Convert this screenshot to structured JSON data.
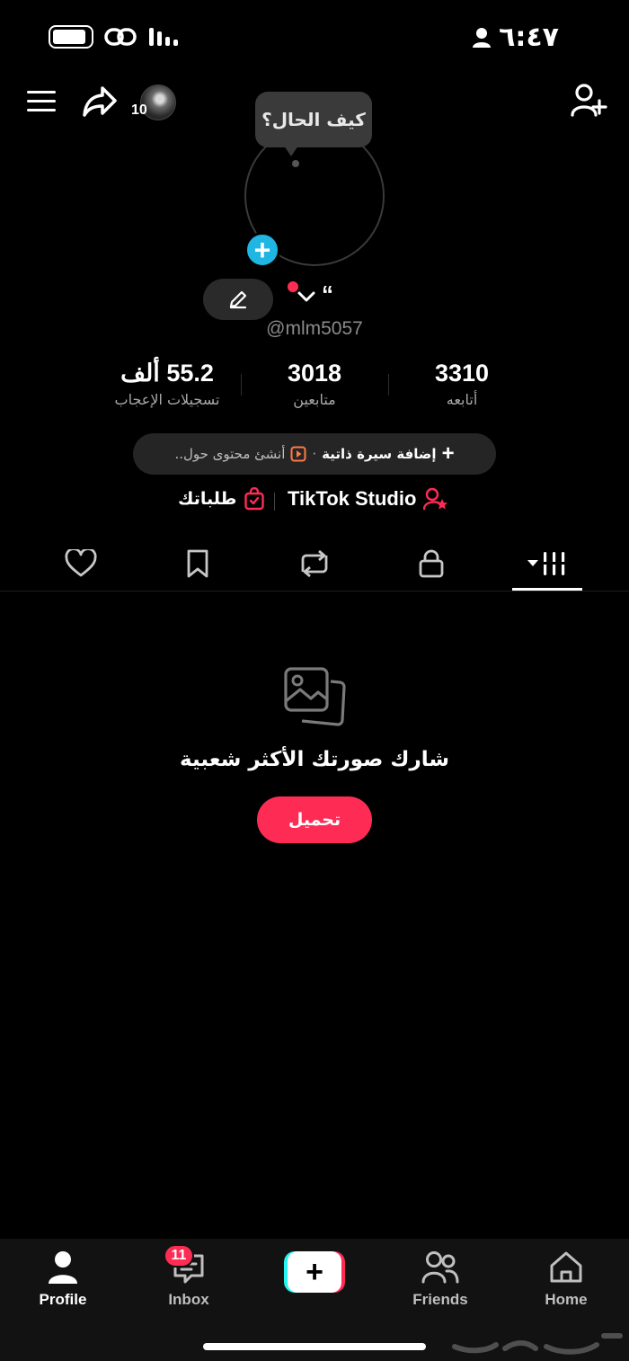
{
  "status_bar": {
    "time": "٦:٤٧",
    "battery_level": 0.9
  },
  "header": {
    "avatar_count": "10"
  },
  "profile": {
    "note_bubble": "كيف الحال؟",
    "display_name": "“",
    "username": "@mlm5057"
  },
  "stats": [
    {
      "value": "3310",
      "label": "أتابعه"
    },
    {
      "value": "3018",
      "label": "متابعين"
    },
    {
      "value": "55.2 ألف",
      "label": "تسجيلات الإعجاب"
    }
  ],
  "bio": {
    "add_label": "إضافة سيرة ذاتية",
    "separator": "·",
    "create_label": "أنشئ محتوى حول.."
  },
  "links": {
    "studio": "TikTok Studio",
    "orders": "طلباتك"
  },
  "tabs": [
    "videos-grid",
    "private",
    "reposts",
    "favorites",
    "liked"
  ],
  "empty_state": {
    "title": "شارك صورتك الأكثر شعبية",
    "button": "تحميل"
  },
  "bottom_nav": {
    "home": "Home",
    "friends": "Friends",
    "inbox": "Inbox",
    "inbox_badge": "11",
    "profile": "Profile"
  },
  "colors": {
    "accent": "#fe2c55",
    "add_photo": "#1fb6e3",
    "studio_accent": "#fe2c55",
    "create_cyan": "#25f4ee"
  }
}
